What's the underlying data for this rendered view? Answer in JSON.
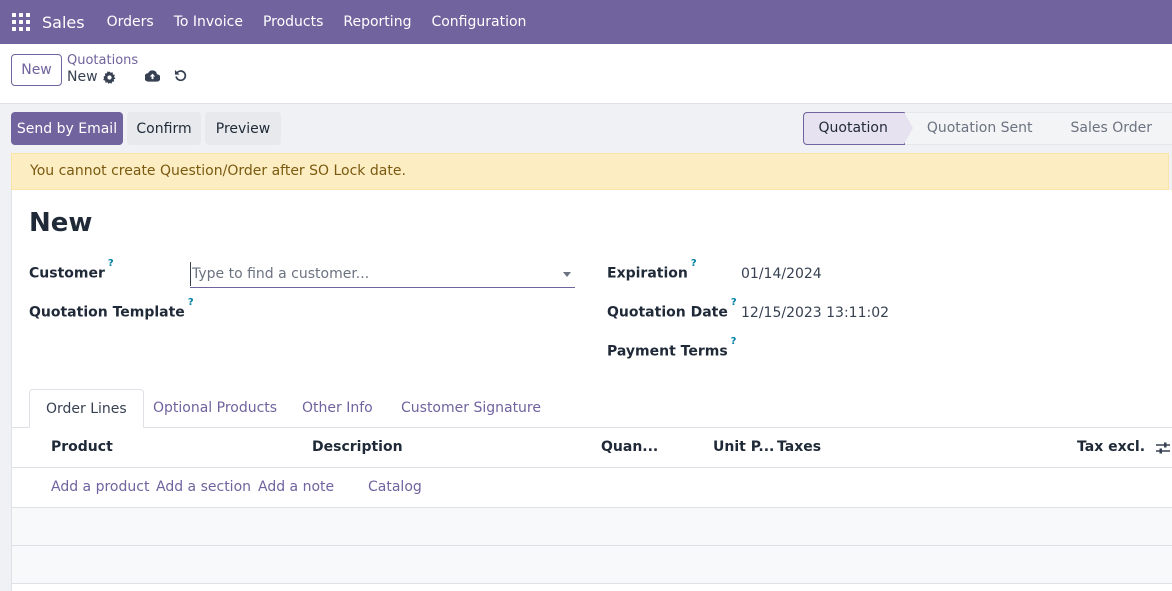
{
  "navbar": {
    "brand": "Sales",
    "menu": [
      "Orders",
      "To Invoice",
      "Products",
      "Reporting",
      "Configuration"
    ]
  },
  "control_panel": {
    "new_label": "New",
    "breadcrumb_parent": "Quotations",
    "breadcrumb_current": "New"
  },
  "actions": {
    "send_email": "Send by Email",
    "confirm": "Confirm",
    "preview": "Preview"
  },
  "statusbar": {
    "stages": [
      "Quotation",
      "Quotation Sent",
      "Sales Order"
    ],
    "active": "Quotation"
  },
  "alert": "You cannot create Question/Order after SO Lock date.",
  "form": {
    "title": "New",
    "customer_label": "Customer",
    "customer_placeholder": "Type to find a customer...",
    "template_label": "Quotation Template",
    "expiration_label": "Expiration",
    "expiration_value": "01/14/2024",
    "quotation_date_label": "Quotation Date",
    "quotation_date_value": "12/15/2023 13:11:02",
    "payment_terms_label": "Payment Terms",
    "help_mark": "?"
  },
  "tabs": [
    "Order Lines",
    "Optional Products",
    "Other Info",
    "Customer Signature"
  ],
  "table": {
    "headers": [
      "Product",
      "Description",
      "Quan...",
      "Unit P...",
      "Taxes",
      "Tax excl."
    ],
    "add_links": [
      "Add a product",
      "Add a section",
      "Add a note",
      "Catalog"
    ]
  },
  "colors": {
    "brand": "#71639e",
    "alert_bg": "#fdedc2",
    "help": "#0180a5"
  }
}
